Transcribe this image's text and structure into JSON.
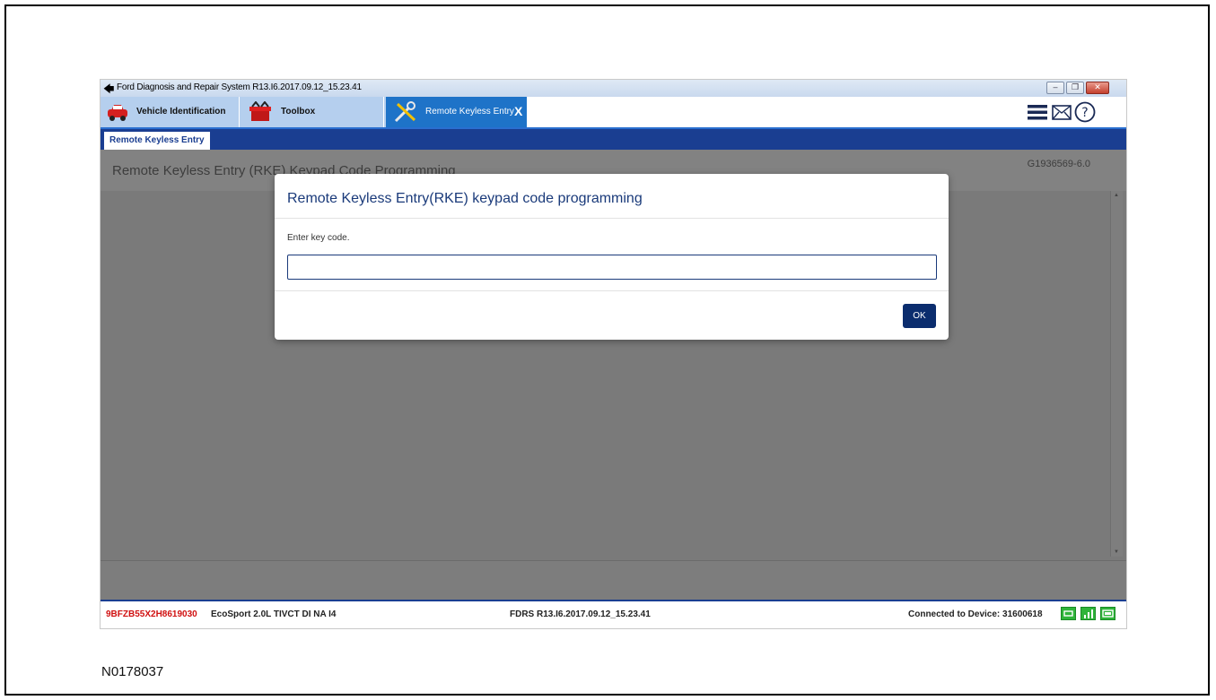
{
  "window": {
    "title": "Ford Diagnosis and Repair System R13.I6.2017.09.12_15.23.41"
  },
  "tabs": [
    {
      "label": "Vehicle Identification",
      "icon": "car-icon"
    },
    {
      "label": "Toolbox",
      "icon": "toolbox-icon"
    },
    {
      "label": "Remote Keyless Entry",
      "icon": "tools-icon",
      "active": true,
      "close": "X"
    }
  ],
  "subtab": {
    "label": "Remote Keyless Entry"
  },
  "content": {
    "heading": "Remote Keyless Entry (RKE) Keypad Code Programming",
    "doc_id": "G1936569-6.0"
  },
  "dialog": {
    "title": "Remote Keyless Entry(RKE) keypad code programming",
    "prompt": "Enter key code.",
    "input_value": "",
    "ok_label": "OK"
  },
  "status": {
    "vin": "9BFZB55X2H8619030",
    "vehicle": "EcoSport 2.0L TIVCT DI NA I4",
    "version": "FDRS R13.I6.2017.09.12_15.23.41",
    "connection": "Connected to Device: 31600618"
  },
  "caption": "N0178037",
  "colors": {
    "accent_blue": "#1e73c8",
    "dark_blue": "#1a3e91",
    "vin_red": "#d01010",
    "status_green": "#2fb43a"
  }
}
